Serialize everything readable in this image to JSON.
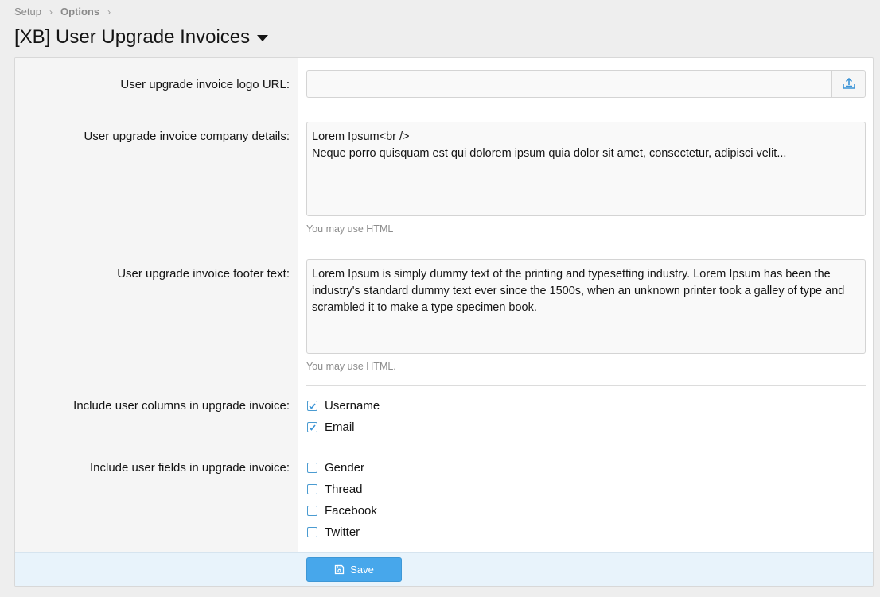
{
  "breadcrumb": {
    "items": [
      "Setup",
      "Options"
    ]
  },
  "page": {
    "title": "[XB] User Upgrade Invoices"
  },
  "form": {
    "logo_url": {
      "label": "User upgrade invoice logo URL:",
      "value": ""
    },
    "company_details": {
      "label": "User upgrade invoice company details:",
      "value": "Lorem Ipsum<br />\nNeque porro quisquam est qui dolorem ipsum quia dolor sit amet, consectetur, adipisci velit...",
      "hint": "You may use HTML"
    },
    "footer_text": {
      "label": "User upgrade invoice footer text:",
      "value": "Lorem Ipsum is simply dummy text of the printing and typesetting industry. Lorem Ipsum has been the industry's standard dummy text ever since the 1500s, when an unknown printer took a galley of type and scrambled it to make a type specimen book.",
      "hint": "You may use HTML."
    },
    "user_columns": {
      "label": "Include user columns in upgrade invoice:",
      "options": [
        {
          "label": "Username",
          "checked": true
        },
        {
          "label": "Email",
          "checked": true
        }
      ]
    },
    "user_fields": {
      "label": "Include user fields in upgrade invoice:",
      "options": [
        {
          "label": "Gender",
          "checked": false
        },
        {
          "label": "Thread",
          "checked": false
        },
        {
          "label": "Facebook",
          "checked": false
        },
        {
          "label": "Twitter",
          "checked": false
        }
      ]
    }
  },
  "actions": {
    "save_label": "Save"
  },
  "icons": {
    "upload": "upload-icon",
    "save": "save-icon",
    "check": "checkmark-icon",
    "chevron": "chevron-right-icon",
    "caret": "caret-down-icon"
  },
  "colors": {
    "accent": "#47a7eb",
    "footer_bg": "#e8f3fb",
    "checkbox_border": "#4a9bd1"
  }
}
